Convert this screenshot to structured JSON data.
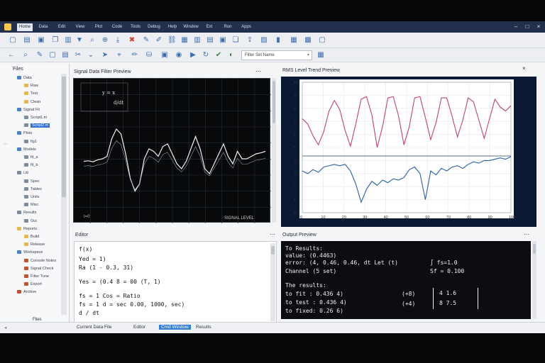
{
  "window": {
    "tabs": [
      "Home",
      "Data",
      "Edit",
      "View",
      "Plot",
      "Code",
      "Tools",
      "Debug",
      "Help",
      "Window",
      "Ext",
      "Run",
      "Apps"
    ],
    "active_tab": 0
  },
  "toolbar": {
    "combo_value": "Filter Set Name"
  },
  "sidebar": {
    "title": "Files",
    "items": [
      {
        "label": "Data",
        "level": 1,
        "color": "#4a7fd0"
      },
      {
        "label": "Raw",
        "level": 2,
        "color": "#e8b84a"
      },
      {
        "label": "Test",
        "level": 2,
        "color": "#e8b84a"
      },
      {
        "label": "Clean",
        "level": 2,
        "color": "#e8b84a"
      },
      {
        "label": "Signal Fit",
        "level": 1,
        "color": "#4a7fd0"
      },
      {
        "label": "Script1.m",
        "level": 2,
        "color": "#7a8aa0"
      },
      {
        "label": "Script2.m",
        "level": 2,
        "color": "#7a8aa0",
        "selected": true
      },
      {
        "label": "Plots",
        "level": 1,
        "color": "#4a7fd0"
      },
      {
        "label": "fig1",
        "level": 2,
        "color": "#7a8aa0"
      },
      {
        "label": "Models",
        "level": 1,
        "color": "#4a7fd0"
      },
      {
        "label": "fit_a",
        "level": 2,
        "color": "#7a8aa0"
      },
      {
        "label": "fit_b",
        "level": 2,
        "color": "#7a8aa0"
      },
      {
        "label": "Lib",
        "level": 1,
        "color": "#7a8aa0"
      },
      {
        "label": "Spec",
        "level": 2,
        "color": "#7a8aa0"
      },
      {
        "label": "Tables",
        "level": 2,
        "color": "#7a8aa0"
      },
      {
        "label": "Units",
        "level": 2,
        "color": "#7a8aa0"
      },
      {
        "label": "Misc",
        "level": 2,
        "color": "#7a8aa0"
      },
      {
        "label": "Results",
        "level": 1,
        "color": "#7a8aa0"
      },
      {
        "label": "Out",
        "level": 2,
        "color": "#7a8aa0"
      },
      {
        "label": "Reports",
        "level": 1,
        "color": "#e8b84a"
      },
      {
        "label": "Build",
        "level": 2,
        "color": "#e8b84a"
      },
      {
        "label": "Release",
        "level": 2,
        "color": "#e8b84a"
      },
      {
        "label": "Workspace",
        "level": 1,
        "color": "#4a7fd0"
      },
      {
        "label": "Console Notes",
        "level": 2,
        "color": "#c05030"
      },
      {
        "label": "Signal Check",
        "level": 2,
        "color": "#c05030"
      },
      {
        "label": "Filter Tune",
        "level": 2,
        "color": "#c05030"
      },
      {
        "label": "Export",
        "level": 2,
        "color": "#c05030"
      },
      {
        "label": "Archive",
        "level": 1,
        "color": "#c05030"
      }
    ],
    "bottom_tab": "Files"
  },
  "left_plot": {
    "title": "Signal Data Filter Preview",
    "corner_label": "t=0",
    "footer": "SIGNAL LEVEL",
    "formula_lines": [
      "y = x",
      "d/dt"
    ]
  },
  "right_plot": {
    "title": "RMS Level Trend Preview",
    "y_ticks": [
      "10",
      "9",
      "8",
      "7",
      "6",
      "5",
      "4",
      "3",
      "2",
      "1",
      "0"
    ],
    "x_ticks": [
      "0",
      "10",
      "20",
      "30",
      "40",
      "50",
      "60",
      "70",
      "80",
      "90",
      "100"
    ]
  },
  "console": {
    "title": "Editor",
    "lines": [
      "f(x)",
      "  Yed = 1)",
      "  Ra  (1 - 0.3, 31)",
      "Yes = (0.4 8 = 00 (T, 1)",
      "fs = 1         Cos = Ratio",
      "fs = 1         d = sec 0.00, 1000, sec)",
      "               d / dt"
    ]
  },
  "output": {
    "title": "Output Preview",
    "lines": [
      "To Results:",
      "  value: (0.4463)",
      "  error: (4, 0.46, 0.46, dt Let (t)",
      "  Channel (5 set)",
      "The results:",
      "  to fit  : 0.436 4)",
      "  to test : 0.436 4)",
      "  to fixed: 0.26 6)"
    ],
    "right_lines": [
      "∫  fs=1.0",
      "   Sf = 0.100"
    ],
    "matrix_rows": [
      [
        "(+8)",
        "4  1.6"
      ],
      [
        "(+4)",
        "8  7.5"
      ]
    ]
  },
  "statusbar": {
    "items": [
      "Current Data File",
      "Editor",
      "Cmd Window",
      "Results"
    ]
  },
  "chart_data": [
    {
      "type": "line",
      "title": "Signal Data Filter Preview",
      "xlabel": "",
      "ylabel": "",
      "grid": true,
      "series": [
        {
          "values": [
            0.05,
            0.06,
            0.04,
            0.08,
            0.1,
            0.15,
            0.5,
            0.7,
            0.6,
            0.2,
            -0.3,
            -0.55,
            -0.4,
            0.1,
            0.3,
            0.25,
            0.15,
            0.35,
            0.4,
            0.2,
            0.0,
            -0.1,
            0.05,
            0.3,
            0.55,
            0.3,
            -0.1,
            -0.2,
            0.0,
            0.2,
            0.4,
            0.15,
            0.0,
            0.25,
            0.1,
            0.1,
            0.15,
            0.2,
            0.22,
            0.25
          ]
        }
      ]
    },
    {
      "type": "line",
      "title": "RMS Level Trend Preview",
      "xlabel": "",
      "ylabel": "",
      "ylim": [
        0,
        10
      ],
      "grid": true,
      "series": [
        {
          "color": "#c0407a",
          "values": [
            7.2,
            6.8,
            5.9,
            5.2,
            6.2,
            7.8,
            8.6,
            7.9,
            6.3,
            5.1,
            6.8,
            8.7,
            8.9,
            7.5,
            5.0,
            6.6,
            8.8,
            8.9,
            7.4,
            5.2,
            6.6,
            8.8,
            8.9,
            7.3,
            5.6,
            6.9,
            8.8,
            8.8,
            7.4,
            5.8,
            7.1,
            8.8,
            8.5,
            7.1,
            5.7,
            7.2,
            8.7,
            8.1,
            7.8,
            8.2
          ]
        },
        {
          "color": "#2a5fa8",
          "values": [
            3.2,
            3.0,
            3.3,
            3.1,
            3.5,
            3.6,
            3.7,
            3.6,
            3.7,
            3.2,
            2.2,
            0.8,
            1.8,
            2.4,
            2.1,
            2.5,
            2.3,
            2.6,
            2.5,
            2.7,
            3.3,
            3.5,
            3.0,
            1.0,
            3.2,
            2.9,
            3.4,
            3.2,
            3.5,
            3.6,
            3.4,
            3.7,
            3.9,
            3.8,
            4.0,
            4.0,
            4.1,
            4.2,
            4.1,
            4.3
          ]
        }
      ]
    }
  ]
}
